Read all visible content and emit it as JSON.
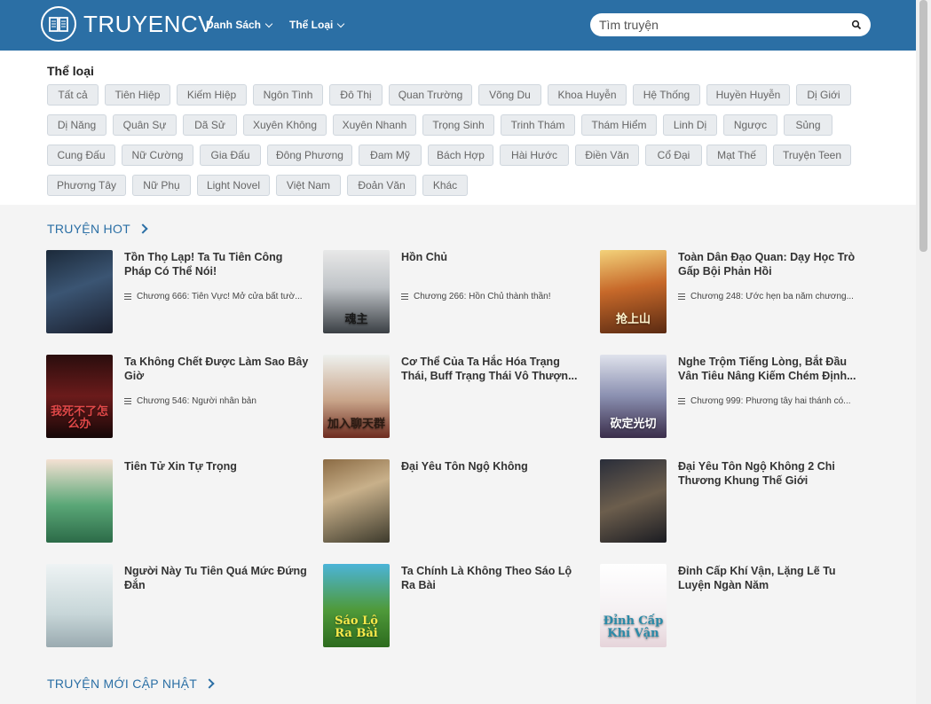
{
  "header": {
    "logo_text": "TRUYENCV",
    "nav": [
      {
        "label": "Danh Sách"
      },
      {
        "label": "Thể Loại"
      }
    ],
    "search_placeholder": "Tìm truyện"
  },
  "genres": {
    "title": "Thể loại",
    "items": [
      "Tất cả",
      "Tiên Hiệp",
      "Kiếm Hiệp",
      "Ngôn Tình",
      "Đô Thị",
      "Quan Trường",
      "Võng Du",
      "Khoa Huyễn",
      "Hệ Thống",
      "Huyền Huyễn",
      "Dị Giới",
      "Dị Năng",
      "Quân Sự",
      "Dã Sử",
      "Xuyên Không",
      "Xuyên Nhanh",
      "Trọng Sinh",
      "Trinh Thám",
      "Thám Hiểm",
      "Linh Dị",
      "Ngược",
      "Sủng",
      "Cung Đấu",
      "Nữ Cường",
      "Gia Đấu",
      "Đông Phương",
      "Đam Mỹ",
      "Bách Hợp",
      "Hài Hước",
      "Điền Văn",
      "Cổ Đại",
      "Mạt Thế",
      "Truyện Teen",
      "Phương Tây",
      "Nữ Phụ",
      "Light Novel",
      "Việt Nam",
      "Đoản Văn",
      "Khác"
    ]
  },
  "hot": {
    "title": "TRUYỆN HOT",
    "stories": [
      {
        "title": "Tồn Thọ Lạp! Ta Tu Tiên Công Pháp Có Thể Nói!",
        "chapter": "Chương 666: Tiên Vực! Mở cửa bất tườ..."
      },
      {
        "title": "Hồn Chủ",
        "chapter": "Chương 266: Hồn Chủ thành thần!"
      },
      {
        "title": "Toàn Dân Đạo Quan: Dạy Học Trò Gấp Bội Phản Hồi",
        "chapter": "Chương 248: Ước hẹn ba năm chương..."
      },
      {
        "title": "Ta Không Chết Được Làm Sao Bây Giờ",
        "chapter": "Chương 546: Người nhân bản"
      },
      {
        "title": "Cơ Thể Của Ta Hắc Hóa Trạng Thái, Buff Trạng Thái Vô Thượn...",
        "chapter": ""
      },
      {
        "title": "Nghe Trộm Tiếng Lòng, Bắt Đầu Vân Tiêu Nâng Kiếm Chém Định...",
        "chapter": "Chương 999: Phương tây hai thánh có..."
      },
      {
        "title": "Tiên Tử Xin Tự Trọng",
        "chapter": ""
      },
      {
        "title": "Đại Yêu Tôn Ngộ Không",
        "chapter": ""
      },
      {
        "title": "Đại Yêu Tôn Ngộ Không 2 Chi Thương Khung Thế Giới",
        "chapter": ""
      },
      {
        "title": "Người Này Tu Tiên Quá Mức Đứng Đắn",
        "chapter": ""
      },
      {
        "title": "Ta Chính Là Không Theo Sáo Lộ Ra Bài",
        "chapter": ""
      },
      {
        "title": "Đỉnh Cấp Khí Vận, Lặng Lẽ Tu Luyện Ngàn Năm",
        "chapter": ""
      }
    ]
  },
  "new_updates": {
    "title": "TRUYỆN MỚI CẬP NHẬT"
  },
  "covers": [
    {
      "text": "",
      "bg": "linear-gradient(160deg,#1c2a3a 0%,#3b5573 45%,#1a1f2e 100%)",
      "color": "#fff"
    },
    {
      "text": "魂主",
      "bg": "linear-gradient(180deg,#e8e8e8 0%,#bfc3c7 45%,#3a3f44 100%)",
      "color": "#1a1a1a"
    },
    {
      "text": "抢上山",
      "bg": "linear-gradient(170deg,#f3d27a 0%,#c7692a 45%,#5a2a12 100%)",
      "color": "#fff6d0"
    },
    {
      "text": "我死不了怎么办",
      "bg": "linear-gradient(180deg,#2a0d0d 0%,#6b1b1b 50%,#150707 100%)",
      "color": "#e04848"
    },
    {
      "text": "加入聊天群",
      "bg": "linear-gradient(180deg,#eef1ee 0%,#c9a58a 55%,#6d2b1f 100%)",
      "color": "#2b1a12"
    },
    {
      "text": "砍定光切",
      "bg": "linear-gradient(180deg,#dfe2ec 0%,#8a8fb0 50%,#3a2d4a 100%)",
      "color": "#fff"
    },
    {
      "text": "",
      "bg": "linear-gradient(180deg,#f4e1d3 0%,#5aa777 55%,#2c6b48 100%)",
      "color": "#fff"
    },
    {
      "text": "",
      "bg": "linear-gradient(160deg,#8b6b44 0%,#c8b08a 40%,#3d3a2c 100%)",
      "color": "#fff"
    },
    {
      "text": "",
      "bg": "linear-gradient(160deg,#2a2e3a 0%,#6c5e4d 50%,#1b1c22 100%)",
      "color": "#fff"
    },
    {
      "text": "",
      "bg": "linear-gradient(180deg,#eef3f4 0%,#c7d6d8 60%,#9aaab0 100%)",
      "color": "#444"
    },
    {
      "text": "Sáo Lộ Ra Bài",
      "bg": "linear-gradient(180deg,#4bb4d8 0%,#4f9a3a 55%,#2d6b1e 100%)",
      "color": "#f8e94a"
    },
    {
      "text": "Đỉnh Cấp Khí Vận",
      "bg": "linear-gradient(180deg,#ffffff 0%,#f4f0f2 60%,#e6d4da 100%)",
      "color": "#2a8aa8"
    }
  ]
}
